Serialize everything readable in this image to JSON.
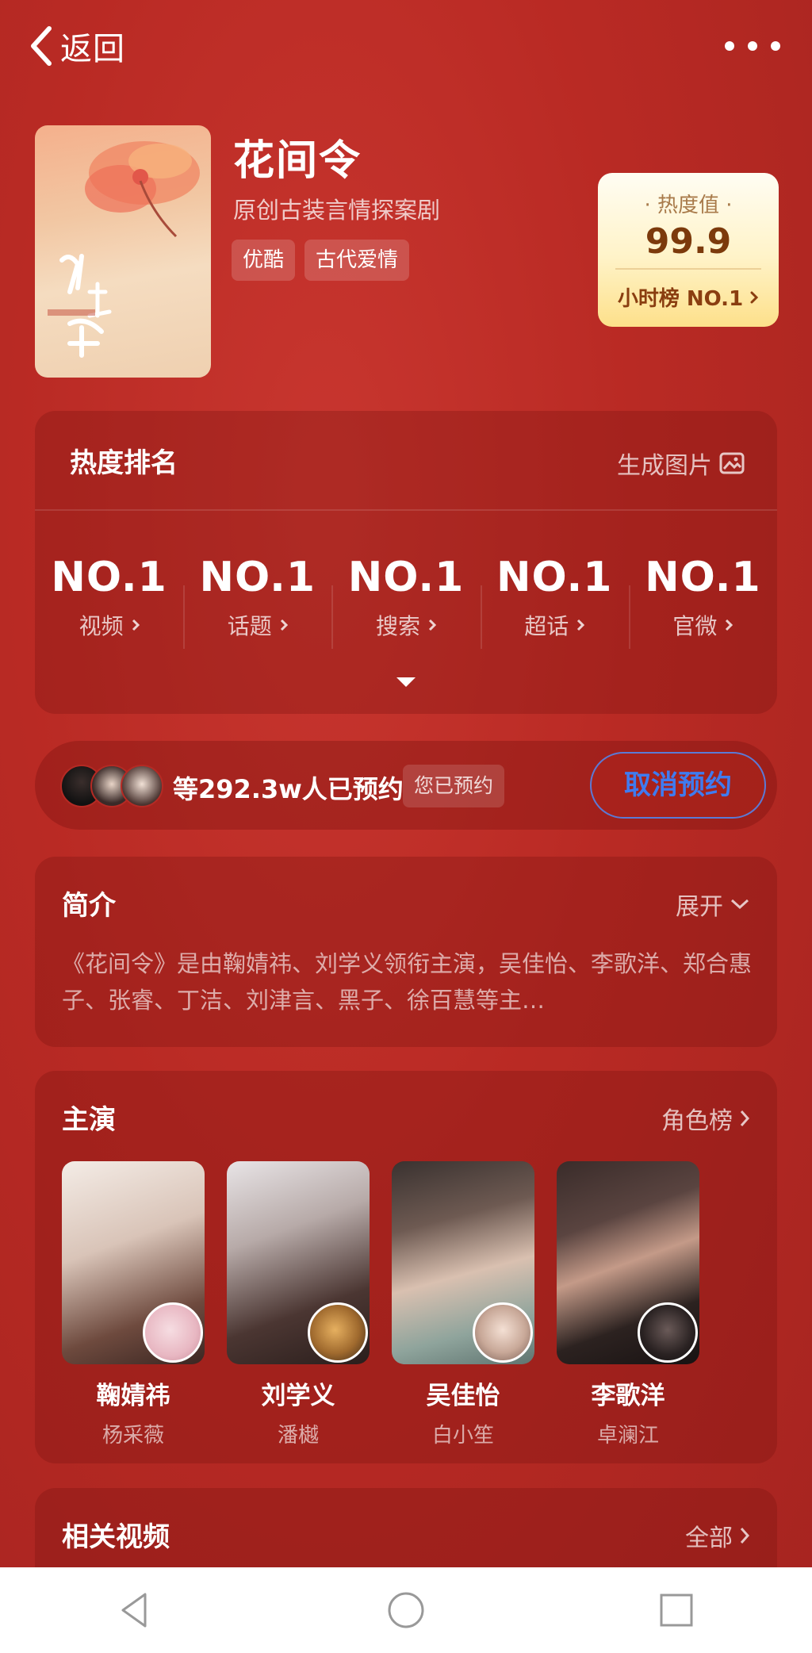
{
  "nav": {
    "back_label": "返回",
    "more_icon": "more-dots-icon"
  },
  "show": {
    "title": "花间令",
    "subtitle": "原创古装言情探案剧",
    "tags": [
      "优酷",
      "古代爱情"
    ]
  },
  "heat_box": {
    "label": "· 热度值 ·",
    "value": "99.9",
    "rank": "小时榜  NO.1"
  },
  "ranking": {
    "title": "热度排名",
    "action": "生成图片",
    "items": [
      {
        "rank": "NO.1",
        "label": "视频"
      },
      {
        "rank": "NO.1",
        "label": "话题"
      },
      {
        "rank": "NO.1",
        "label": "搜索"
      },
      {
        "rank": "NO.1",
        "label": "超话"
      },
      {
        "rank": "NO.1",
        "label": "官微"
      }
    ]
  },
  "reservation": {
    "count_text": "等292.3w人已预约",
    "badge": "您已预约",
    "cancel_label": "取消预约"
  },
  "intro": {
    "title": "简介",
    "action": "展开",
    "text": "《花间令》是由鞠婧祎、刘学义领衔主演，吴佳怡、李歌洋、郑合惠子、张睿、丁洁、刘津言、黑子、徐百慧等主…"
  },
  "cast": {
    "title": "主演",
    "action": "角色榜",
    "members": [
      {
        "name": "鞠婧祎",
        "role": "杨采薇"
      },
      {
        "name": "刘学义",
        "role": "潘樾"
      },
      {
        "name": "吴佳怡",
        "role": "白小笙"
      },
      {
        "name": "李歌洋",
        "role": "卓澜江"
      }
    ]
  },
  "videos": {
    "title": "相关视频",
    "action": "全部"
  },
  "colors": {
    "background": "#b92a24",
    "accent_blue": "#3f7bf0",
    "heat_text": "#7c3a0c"
  }
}
